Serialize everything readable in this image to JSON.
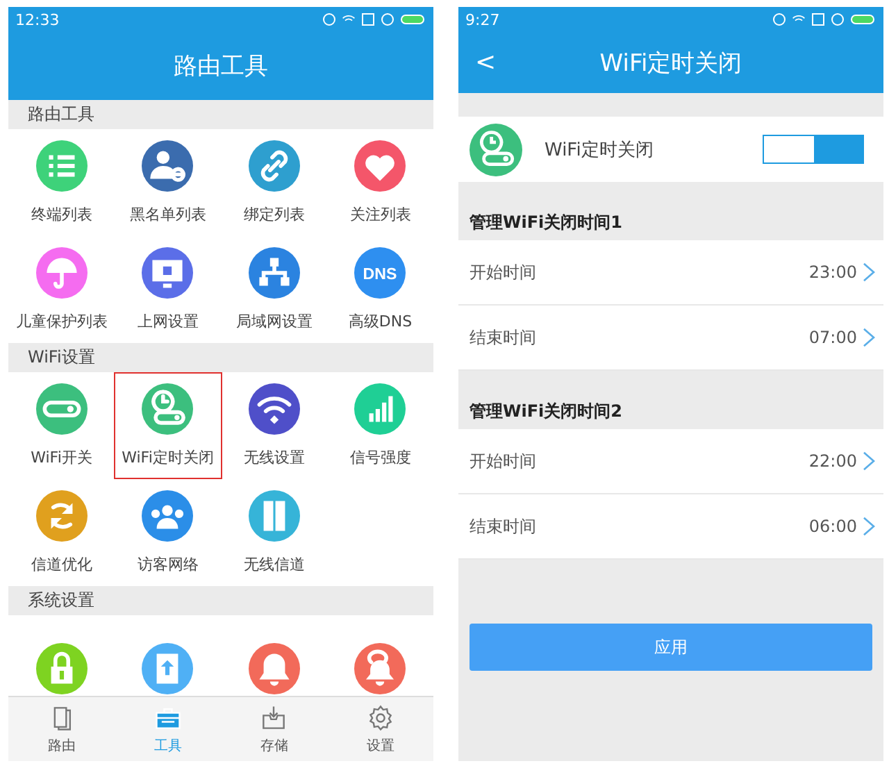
{
  "tools_screen": {
    "status_bar": {
      "time": "12:33"
    },
    "title": "路由工具",
    "sections": [
      {
        "title": "路由工具",
        "items": [
          {
            "label": "终端列表",
            "kind": "list",
            "color": "#3ed27a",
            "selected": false
          },
          {
            "label": "黑名单列表",
            "kind": "person",
            "color": "#3b6cae",
            "selected": false
          },
          {
            "label": "绑定列表",
            "kind": "link",
            "color": "#2e9fcf",
            "selected": false
          },
          {
            "label": "关注列表",
            "kind": "heart",
            "color": "#f4566a",
            "selected": false
          },
          {
            "label": "儿童保护列表",
            "kind": "umbrella",
            "color": "#f56cf0",
            "selected": false
          },
          {
            "label": "上网设置",
            "kind": "monitor",
            "color": "#5b6ee8",
            "selected": false
          },
          {
            "label": "局域网设置",
            "kind": "network",
            "color": "#2b83e0",
            "selected": false
          },
          {
            "label": "高级DNS",
            "kind": "text",
            "icon_text": "DNS",
            "color": "#2e8ff0",
            "selected": false
          }
        ]
      },
      {
        "title": "WiFi设置",
        "items": [
          {
            "label": "WiFi开关",
            "kind": "toggle",
            "color": "#3cbf7e",
            "selected": false
          },
          {
            "label": "WiFi定时关闭",
            "kind": "clock",
            "color": "#3cbf7e",
            "selected": true
          },
          {
            "label": "无线设置",
            "kind": "wifi",
            "color": "#4f4fc9",
            "selected": false
          },
          {
            "label": "信号强度",
            "kind": "signal",
            "color": "#1fcf95",
            "selected": false
          },
          {
            "label": "信道优化",
            "kind": "arrows",
            "color": "#e0a01e",
            "selected": false
          },
          {
            "label": "访客网络",
            "kind": "people",
            "color": "#2b8ee8",
            "selected": false
          },
          {
            "label": "无线信道",
            "kind": "door",
            "color": "#36b4d8",
            "selected": false
          }
        ]
      },
      {
        "title": "系统设置",
        "items": [
          {
            "kind": "lock",
            "color": "#7ed321",
            "selected": false
          },
          {
            "kind": "upload",
            "color": "#4fb0f5",
            "selected": false
          },
          {
            "kind": "bell",
            "color": "#f26a5a",
            "selected": false
          },
          {
            "kind": "bubble",
            "color": "#f26a5a",
            "selected": false
          }
        ]
      }
    ],
    "tab_bar": [
      {
        "label": "路由",
        "kind": "phones",
        "selected": false
      },
      {
        "label": "工具",
        "kind": "toolbox",
        "selected": true
      },
      {
        "label": "存储",
        "kind": "tray",
        "selected": false
      },
      {
        "label": "设置",
        "kind": "gear",
        "selected": false
      }
    ]
  },
  "timer_screen": {
    "status_bar": {
      "time": "9:27"
    },
    "back": "<",
    "title": "WiFi定时关闭",
    "toggle": {
      "label": "WiFi定时关闭",
      "on": true
    },
    "groups": [
      {
        "title": "管理WiFi关闭时间1",
        "rows": [
          {
            "label": "开始时间",
            "value": "23:00"
          },
          {
            "label": "结束时间",
            "value": "07:00"
          }
        ]
      },
      {
        "title": "管理WiFi关闭时间2",
        "rows": [
          {
            "label": "开始时间",
            "value": "22:00"
          },
          {
            "label": "结束时间",
            "value": "06:00"
          }
        ]
      }
    ],
    "apply_button": "应用"
  }
}
